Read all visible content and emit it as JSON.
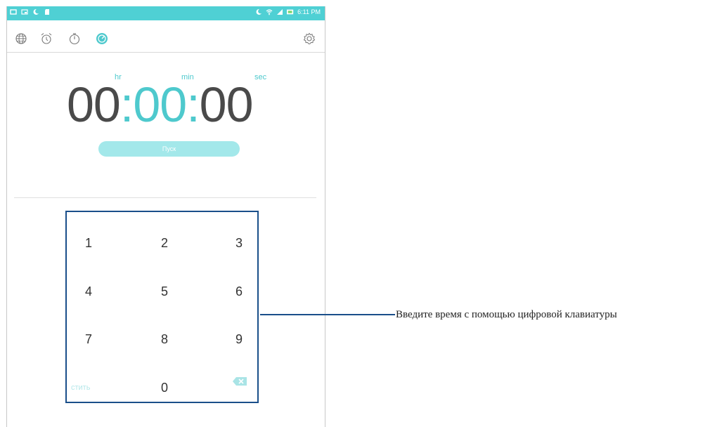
{
  "status_bar": {
    "time": "6:11 PM"
  },
  "toolbar": {
    "icons": [
      "world-clock-icon",
      "alarm-icon",
      "stopwatch-icon",
      "timer-icon",
      "settings-icon"
    ],
    "active": "timer-icon"
  },
  "timer": {
    "hr_label": "hr",
    "min_label": "min",
    "sec_label": "sec",
    "hours": "00",
    "minutes": "00",
    "seconds": "00",
    "sep1": ":",
    "sep2": ":"
  },
  "start_button": {
    "label": "Пуск"
  },
  "keypad": {
    "k1": "1",
    "k2": "2",
    "k3": "3",
    "k4": "4",
    "k5": "5",
    "k6": "6",
    "k7": "7",
    "k8": "8",
    "k9": "9",
    "clear": "стить",
    "k0": "0"
  },
  "callout": {
    "text": "Введите время с помощью цифровой клавиатуры"
  },
  "colors": {
    "accent": "#4ec9cd",
    "status_bar": "#4fd0d4",
    "callout": "#1a4f8a"
  }
}
